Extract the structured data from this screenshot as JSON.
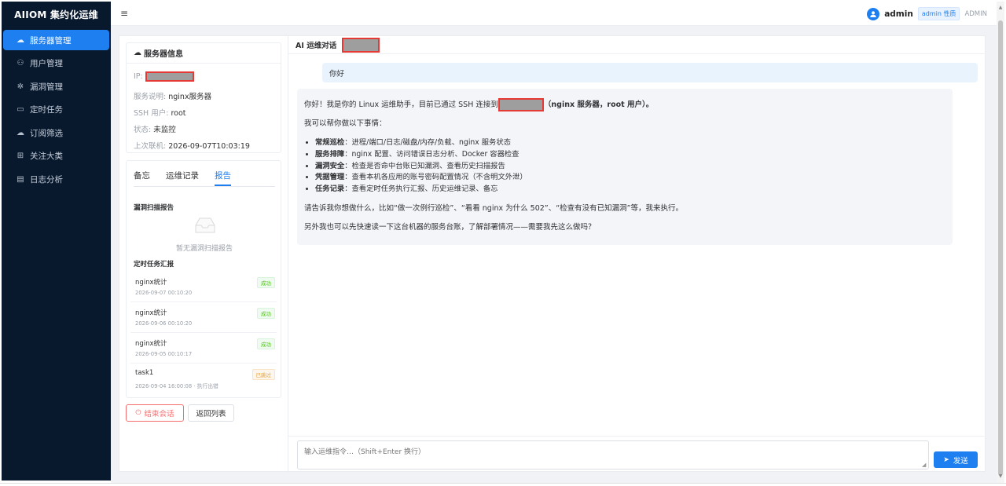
{
  "brand": "AIIOM 集约化运维",
  "sidebar": {
    "items": [
      {
        "label": "服务器管理",
        "icon": "cloud-server-icon",
        "active": true
      },
      {
        "label": "用户管理",
        "icon": "users-icon",
        "active": false
      },
      {
        "label": "漏洞管理",
        "icon": "bug-icon",
        "active": false
      },
      {
        "label": "定时任务",
        "icon": "calendar-icon",
        "active": false
      },
      {
        "label": "订阅筛选",
        "icon": "cloud-upload-icon",
        "active": false
      },
      {
        "label": "关注大类",
        "icon": "grid-icon",
        "active": false
      },
      {
        "label": "日志分析",
        "icon": "document-icon",
        "active": false
      }
    ]
  },
  "header": {
    "menu_icon": "≡",
    "username": "admin",
    "role_badge": "admin 性质",
    "role": "ADMIN"
  },
  "server_info": {
    "title": "服务器信息",
    "ip_label": "IP:",
    "desc_label": "服务说明:",
    "desc_value": "nginx服务器",
    "ssh_label": "SSH 用户:",
    "ssh_value": "root",
    "status_label": "状态:",
    "status_value": "未监控",
    "last_label": "上次联机:",
    "last_value": "2026-09-07T10:03:19"
  },
  "tabs": [
    {
      "label": "备忘",
      "active": false
    },
    {
      "label": "运维记录",
      "active": false
    },
    {
      "label": "报告",
      "active": true
    }
  ],
  "report": {
    "vuln_title": "漏洞扫描报告",
    "vuln_empty": "暂无漏洞扫描报告",
    "task_title": "定时任务汇报",
    "tasks": [
      {
        "name": "nginx统计",
        "time": "2026-09-07 00:10:20",
        "status": "成功",
        "kind": "ok"
      },
      {
        "name": "nginx统计",
        "time": "2026-09-06 00:10:20",
        "status": "成功",
        "kind": "ok"
      },
      {
        "name": "nginx统计",
        "time": "2026-09-05 00:10:17",
        "status": "成功",
        "kind": "ok"
      },
      {
        "name": "task1",
        "time": "2026-09-04 16:00:08 · 执行出错",
        "status": "已跳过",
        "kind": "skip"
      }
    ]
  },
  "buttons": {
    "end_session": "结束会话",
    "back_list": "返回列表",
    "send": "发送"
  },
  "chat": {
    "title": "AI 运维对话",
    "user_message": "你好",
    "ai": {
      "intro_prefix": "你好！我是你的 Linux 运维助手，目前已通过 SSH 连接到",
      "intro_suffix": "（nginx 服务器，root 用户）。",
      "can_help": "我可以帮你做以下事情：",
      "items": [
        {
          "bold": "常规巡检",
          "text": "：进程/端口/日志/磁盘/内存/负载、nginx 服务状态"
        },
        {
          "bold": "服务排障",
          "text": "：nginx 配置、访问错误日志分析、Docker 容器检查"
        },
        {
          "bold": "漏洞安全",
          "text": "：检查是否命中台账已知漏洞、查看历史扫描报告"
        },
        {
          "bold": "凭据管理",
          "text": "：查看本机各应用的账号密码配置情况（不含明文外泄）"
        },
        {
          "bold": "任务记录",
          "text": "：查看定时任务执行汇报、历史运维记录、备忘"
        }
      ],
      "ask": "请告诉我你想做什么，比如“做一次例行巡检”、“看看 nginx 为什么 502”、“检查有没有已知漏洞”等，我来执行。",
      "offer": "另外我也可以先快速读一下这台机器的服务台账，了解部署情况——需要我先这么做吗？"
    },
    "input_placeholder": "输入运维指令…（Shift+Enter 换行）"
  }
}
